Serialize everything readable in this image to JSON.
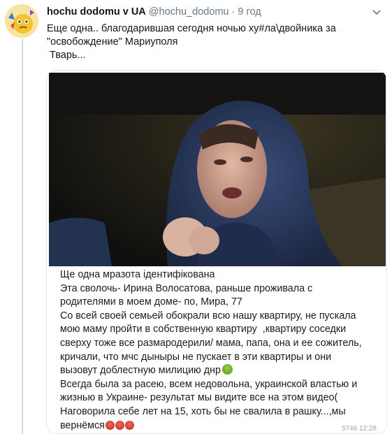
{
  "tweet": {
    "author_name": "hochu dodomu v UA",
    "author_handle": "@hochu_dodomu",
    "separator": "·",
    "time": "9 год",
    "text_lines": [
      "Еще одна.. благодарившая  сегодня ночью ху#ла\\двойника за",
      "\"освобождение\" Мариуполя",
      " Тварь..."
    ]
  },
  "media": {
    "caption_lines": [
      "Ще одна мразота ідентифікована",
      "Эта сволочь- Ирина Волосатова, раньше проживала с",
      "родителями в моем доме- по, Мира, 77",
      "Со всей своей семьей обокрали всю нашу квартиру, не пускала",
      "мою маму пройти в собственную квартиру  ,квартиру соседки",
      "сверху тоже все размародерили/ мама, папа, она и ее сожитель,",
      "кричали, что мчс дыныры не пускает в эти квартиры и они",
      "вызовут доблестную милицию днр",
      "Всегда была за расею, всем недовольна, украинской властью и",
      "жизнью в Украине- результат мы видите все на этом видео(",
      "Наговорила себе лет на 15, хоть бы не свалила в рашку...,мы",
      "вернёмся"
    ],
    "views_text": "5746  12:28"
  },
  "icons": {
    "avatar": "avatar-emoji-face",
    "menu": "chevron-down-icon",
    "nauseated": "nauseated-face-emoji",
    "angry": "angry-face-emoji"
  }
}
